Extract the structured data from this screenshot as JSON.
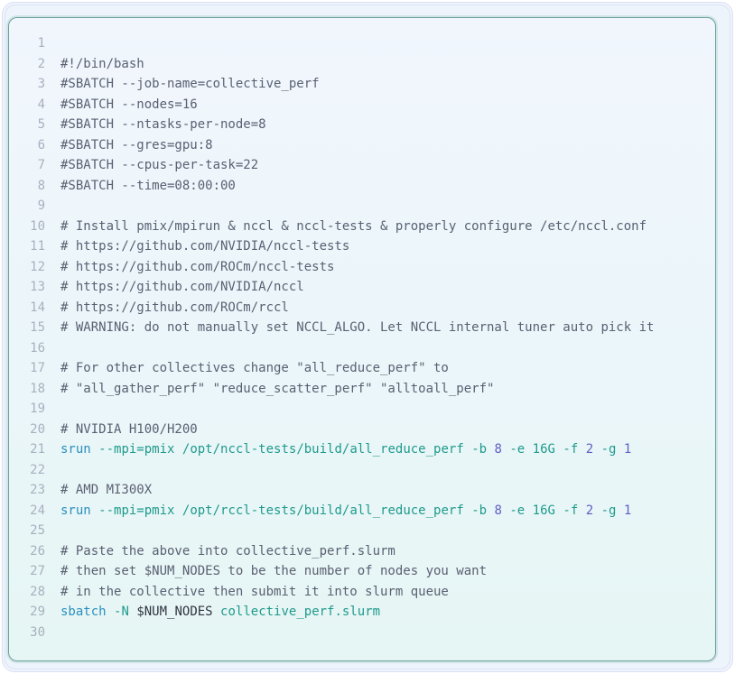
{
  "colors": {
    "comment": "#5a6072",
    "command": "#2a8fbd",
    "argument": "#1f9a8c",
    "number": "#5e5fc4",
    "variable": "#2f3442",
    "line_number": "#a8b0bf"
  },
  "lines": [
    [],
    [
      {
        "t": "#!/bin/bash",
        "c": "cmt"
      }
    ],
    [
      {
        "t": "#SBATCH --job-name=collective_perf",
        "c": "cmt"
      }
    ],
    [
      {
        "t": "#SBATCH --nodes=16",
        "c": "cmt"
      }
    ],
    [
      {
        "t": "#SBATCH --ntasks-per-node=8",
        "c": "cmt"
      }
    ],
    [
      {
        "t": "#SBATCH --gres=gpu:8",
        "c": "cmt"
      }
    ],
    [
      {
        "t": "#SBATCH --cpus-per-task=22",
        "c": "cmt"
      }
    ],
    [
      {
        "t": "#SBATCH --time=08:00:00",
        "c": "cmt"
      }
    ],
    [],
    [
      {
        "t": "# Install pmix/mpirun & nccl & nccl-tests & properly configure /etc/nccl.conf",
        "c": "cmt"
      }
    ],
    [
      {
        "t": "# https://github.com/NVIDIA/nccl-tests",
        "c": "cmt"
      }
    ],
    [
      {
        "t": "# https://github.com/ROCm/nccl-tests",
        "c": "cmt"
      }
    ],
    [
      {
        "t": "# https://github.com/NVIDIA/nccl",
        "c": "cmt"
      }
    ],
    [
      {
        "t": "# https://github.com/ROCm/rccl",
        "c": "cmt"
      }
    ],
    [
      {
        "t": "# WARNING: do not manually set NCCL_ALGO. Let NCCL internal tuner auto pick it",
        "c": "cmt"
      }
    ],
    [],
    [
      {
        "t": "# For other collectives change \"all_reduce_perf\" to",
        "c": "cmt"
      }
    ],
    [
      {
        "t": "# \"all_gather_perf\" \"reduce_scatter_perf\" \"alltoall_perf\"",
        "c": "cmt"
      }
    ],
    [],
    [
      {
        "t": "# NVIDIA H100/H200",
        "c": "cmt"
      }
    ],
    [
      {
        "t": "srun",
        "c": "cmd"
      },
      {
        "t": " ",
        "c": "var"
      },
      {
        "t": "--mpi=pmix",
        "c": "arg"
      },
      {
        "t": " ",
        "c": "var"
      },
      {
        "t": "/opt/nccl-tests/build/all_reduce_perf",
        "c": "arg"
      },
      {
        "t": " ",
        "c": "var"
      },
      {
        "t": "-b",
        "c": "arg"
      },
      {
        "t": " ",
        "c": "var"
      },
      {
        "t": "8",
        "c": "num"
      },
      {
        "t": " ",
        "c": "var"
      },
      {
        "t": "-e",
        "c": "arg"
      },
      {
        "t": " ",
        "c": "var"
      },
      {
        "t": "16G",
        "c": "arg"
      },
      {
        "t": " ",
        "c": "var"
      },
      {
        "t": "-f",
        "c": "arg"
      },
      {
        "t": " ",
        "c": "var"
      },
      {
        "t": "2",
        "c": "num"
      },
      {
        "t": " ",
        "c": "var"
      },
      {
        "t": "-g",
        "c": "arg"
      },
      {
        "t": " ",
        "c": "var"
      },
      {
        "t": "1",
        "c": "num"
      }
    ],
    [],
    [
      {
        "t": "# AMD MI300X",
        "c": "cmt"
      }
    ],
    [
      {
        "t": "srun",
        "c": "cmd"
      },
      {
        "t": " ",
        "c": "var"
      },
      {
        "t": "--mpi=pmix",
        "c": "arg"
      },
      {
        "t": " ",
        "c": "var"
      },
      {
        "t": "/opt/rccl-tests/build/all_reduce_perf",
        "c": "arg"
      },
      {
        "t": " ",
        "c": "var"
      },
      {
        "t": "-b",
        "c": "arg"
      },
      {
        "t": " ",
        "c": "var"
      },
      {
        "t": "8",
        "c": "num"
      },
      {
        "t": " ",
        "c": "var"
      },
      {
        "t": "-e",
        "c": "arg"
      },
      {
        "t": " ",
        "c": "var"
      },
      {
        "t": "16G",
        "c": "arg"
      },
      {
        "t": " ",
        "c": "var"
      },
      {
        "t": "-f",
        "c": "arg"
      },
      {
        "t": " ",
        "c": "var"
      },
      {
        "t": "2",
        "c": "num"
      },
      {
        "t": " ",
        "c": "var"
      },
      {
        "t": "-g",
        "c": "arg"
      },
      {
        "t": " ",
        "c": "var"
      },
      {
        "t": "1",
        "c": "num"
      }
    ],
    [],
    [
      {
        "t": "# Paste the above into collective_perf.slurm",
        "c": "cmt"
      }
    ],
    [
      {
        "t": "# then set $NUM_NODES to be the number of nodes you want",
        "c": "cmt"
      }
    ],
    [
      {
        "t": "# in the collective then submit it into slurm queue",
        "c": "cmt"
      }
    ],
    [
      {
        "t": "sbatch",
        "c": "cmd"
      },
      {
        "t": " ",
        "c": "var"
      },
      {
        "t": "-N",
        "c": "arg"
      },
      {
        "t": " ",
        "c": "var"
      },
      {
        "t": "$NUM_NODES",
        "c": "var"
      },
      {
        "t": " ",
        "c": "var"
      },
      {
        "t": "collective_perf.slurm",
        "c": "arg"
      }
    ],
    []
  ]
}
